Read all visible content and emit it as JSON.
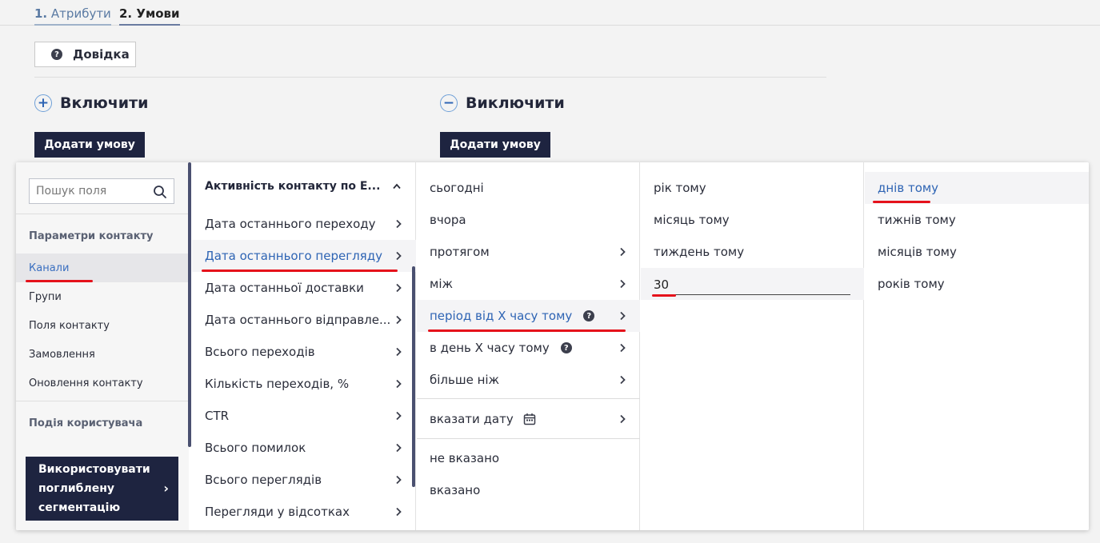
{
  "tabs": [
    {
      "num": "1.",
      "label": "Атрибути"
    },
    {
      "num": "2.",
      "label": "Умови"
    }
  ],
  "help_label": "Довідка",
  "include": {
    "sign": "+",
    "title": "Включити",
    "add_label": "Додати умову"
  },
  "exclude": {
    "sign": "−",
    "title": "Виключити",
    "add_label": "Додати умову"
  },
  "search": {
    "placeholder": "Пошук поля"
  },
  "sidebar": {
    "group1_title": "Параметри контакту",
    "items": [
      "Канали",
      "Групи",
      "Поля контакту",
      "Замовлення",
      "Оновлення контакту"
    ],
    "active_item": "Канали",
    "group2_title": "Подія користувача",
    "deep_button": "Використовувати поглиблену сегментацію"
  },
  "col2": {
    "header": "Активність контакту по E...",
    "items": [
      "Дата останнього переходу",
      "Дата останнього перегляду",
      "Дата останньої доставки",
      "Дата останнього відправле...",
      "Всього переходів",
      "Кількість переходів, %",
      "CTR",
      "Всього помилок",
      "Всього переглядів",
      "Перегляди у відсотках"
    ],
    "selected": "Дата останнього перегляду"
  },
  "col3": {
    "items": [
      "сьогодні",
      "вчора",
      "протягом",
      "між",
      "період від X часу тому",
      "в день X часу тому",
      "більше ніж"
    ],
    "specify_date": "вказати дату",
    "not_specified": "не вказано",
    "specified": "вказано",
    "selected": "період від X часу тому"
  },
  "col4": {
    "items": [
      "рік тому",
      "місяць тому",
      "тиждень тому"
    ],
    "input_value": "30"
  },
  "col5": {
    "items": [
      "днів тому",
      "тижнів тому",
      "місяців тому",
      "років тому"
    ],
    "selected": "днів тому"
  },
  "colors": {
    "accent": "#2e64b4",
    "dark_button": "#1e2440",
    "highlight": "#e5121b"
  }
}
